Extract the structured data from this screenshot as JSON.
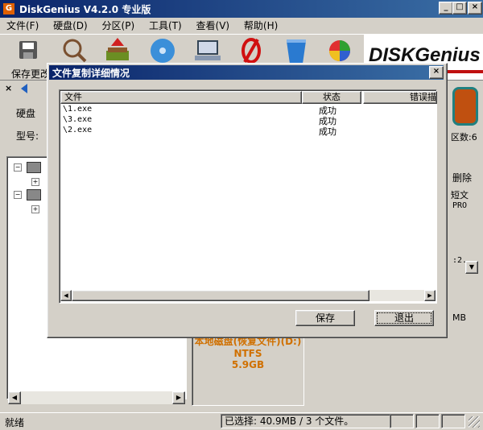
{
  "app": {
    "title": "DiskGenius V4.2.0 专业版",
    "icon_letter": "G"
  },
  "menu": [
    "文件(F)",
    "硬盘(D)",
    "分区(P)",
    "工具(T)",
    "查看(V)",
    "帮助(H)"
  ],
  "toolbar": {
    "save_label": "保存更改",
    "brand_text": "DISKGenius"
  },
  "left": {
    "disk_label": "硬盘",
    "model_label": "型号:",
    "tree": [
      {
        "text": ""
      },
      {
        "text": ""
      }
    ]
  },
  "right": {
    "fragment_partitions": "区数:6",
    "delete_label": "删除",
    "col_frag": "短文",
    "frag_text_1": "PRO",
    "frag_text_2": ":2.",
    "frag_text_3": "MB",
    "partition_title": "本地磁盘(恢复文件)(D:)",
    "partition_fs": "NTFS",
    "partition_size": "5.9GB"
  },
  "dialog": {
    "title": "文件复制详细情况",
    "columns": [
      "文件",
      "状态",
      "错误描"
    ],
    "rows": [
      {
        "file": "\\1.exe",
        "status": "成功",
        "error": ""
      },
      {
        "file": "\\3.exe",
        "status": "成功",
        "error": ""
      },
      {
        "file": "\\2.exe",
        "status": "成功",
        "error": ""
      }
    ],
    "save_button": "保存",
    "exit_button": "退出"
  },
  "statusbar": {
    "left": "就绪",
    "selection": "已选择: 40.9MB / 3 个文件。"
  },
  "colors": {
    "title_start": "#0a246a",
    "title_end": "#3a6ea5",
    "partition_text": "#d07000"
  }
}
